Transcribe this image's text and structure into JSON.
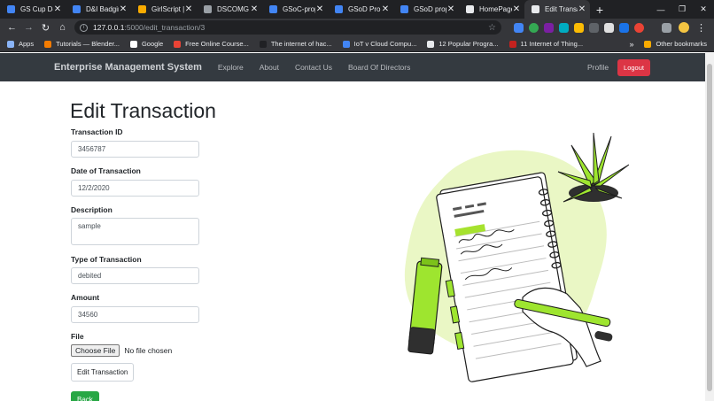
{
  "browser": {
    "tabs": [
      {
        "title": "GS Cup Doc",
        "color": "#4285f4"
      },
      {
        "title": "D&I Badgin",
        "color": "#4285f4"
      },
      {
        "title": "GirlScript |",
        "color": "#f9ab00"
      },
      {
        "title": "DSCOMG 2",
        "color": "#9aa0a6"
      },
      {
        "title": "GSoC-prop",
        "color": "#4285f4"
      },
      {
        "title": "GSoD Prop",
        "color": "#4285f4"
      },
      {
        "title": "GSoD prop",
        "color": "#4285f4"
      },
      {
        "title": "HomePage",
        "color": "#e8eaed"
      },
      {
        "title": "Edit Transa",
        "color": "#e8eaed"
      }
    ],
    "active_tab_index": 8,
    "new_tab": "+",
    "window_controls": [
      "—",
      "❐",
      "✕"
    ],
    "url_host": "127.0.0.1",
    "url_path": ":5000/edit_transaction/3",
    "bookmarks": [
      {
        "label": "Apps",
        "color": "#8ab4f8"
      },
      {
        "label": "Tutorials — Blender...",
        "color": "#f57c00"
      },
      {
        "label": "Google",
        "color": "#ffffff"
      },
      {
        "label": "Free Online Course...",
        "color": "#ea4335"
      },
      {
        "label": "The internet of hac...",
        "color": "#202124"
      },
      {
        "label": "IoT v Cloud Compu...",
        "color": "#4285f4"
      },
      {
        "label": "12 Popular Progra...",
        "color": "#e8eaed"
      },
      {
        "label": "11 Internet of Thing...",
        "color": "#c5221f"
      }
    ],
    "other_bookmarks": "Other bookmarks"
  },
  "navbar": {
    "brand": "Enterprise Management System",
    "links": [
      "Explore",
      "About",
      "Contact Us",
      "Board Of Directors"
    ],
    "profile": "Profile",
    "logout": "Logout"
  },
  "form": {
    "title": "Edit Transaction",
    "transaction_id_label": "Transaction ID",
    "transaction_id_value": "3456787",
    "date_label": "Date of Transaction",
    "date_value": "12/2/2020",
    "description_label": "Description",
    "description_value": "sample",
    "type_label": "Type of Transaction",
    "type_value": "debited",
    "amount_label": "Amount",
    "amount_value": "34560",
    "file_label": "File",
    "file_button": "Choose File",
    "file_status": "No file chosen",
    "submit_button": "Edit Transaction",
    "back_button": "Back"
  },
  "colors": {
    "navbar_bg": "#343a40",
    "logout_bg": "#dc3545",
    "back_bg": "#28a745",
    "illustration_accent": "#a6e22e"
  }
}
